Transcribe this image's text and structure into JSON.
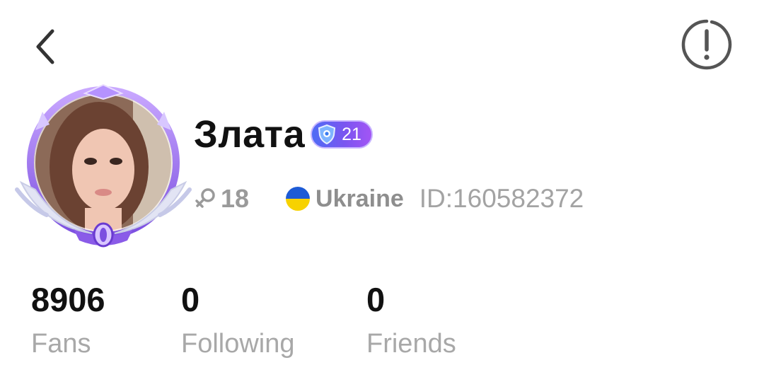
{
  "header": {
    "back_icon": "chevron-left-icon",
    "report_icon": "exclamation-circle-icon"
  },
  "profile": {
    "name": "Злата",
    "level": "21",
    "age": "18",
    "country": "Ukraine",
    "user_id": "ID:160582372",
    "colors": {
      "badge_start": "#4f6cf5",
      "badge_end": "#a355f5",
      "frame": "#9b6cf0"
    }
  },
  "stats": [
    {
      "value": "8906",
      "label": "Fans"
    },
    {
      "value": "0",
      "label": "Following"
    },
    {
      "value": "0",
      "label": "Friends"
    }
  ]
}
